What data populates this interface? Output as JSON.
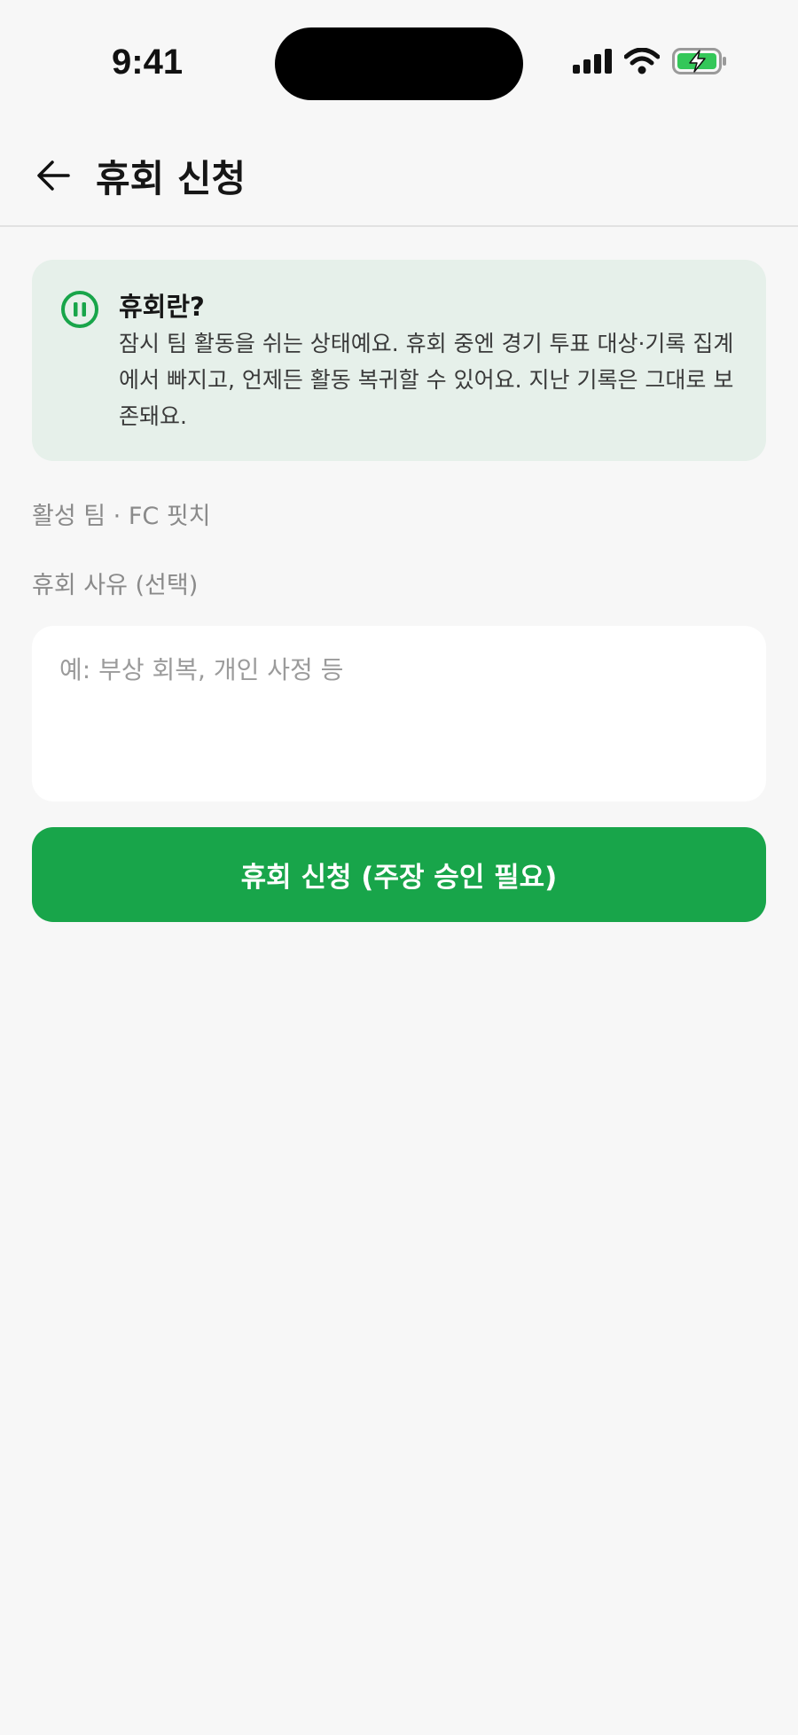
{
  "status_bar": {
    "time": "9:41",
    "icons": [
      "cellular-signal-icon",
      "wifi-icon",
      "battery-charging-icon"
    ]
  },
  "header": {
    "back_icon": "arrow-left-icon",
    "title": "휴회 신청"
  },
  "info_card": {
    "icon": "pause-circle-icon",
    "title": "휴회란?",
    "body": "잠시 팀 활동을 쉬는 상태예요. 휴회 중엔 경기 투표 대상·기록 집계에서 빠지고, 언제든 활동 복귀할 수 있어요. 지난 기록은 그대로 보존돼요."
  },
  "team_label": "활성 팀 · FC 핏치",
  "reason": {
    "label": "휴회 사유 (선택)",
    "placeholder": "예: 부상 회복, 개인 사정 등",
    "value": ""
  },
  "submit_button": {
    "label": "휴회 신청 (주장 승인 필요)"
  },
  "colors": {
    "accent": "#18a54a",
    "info_background": "#e6f0ea",
    "page_background": "#f7f7f7"
  }
}
